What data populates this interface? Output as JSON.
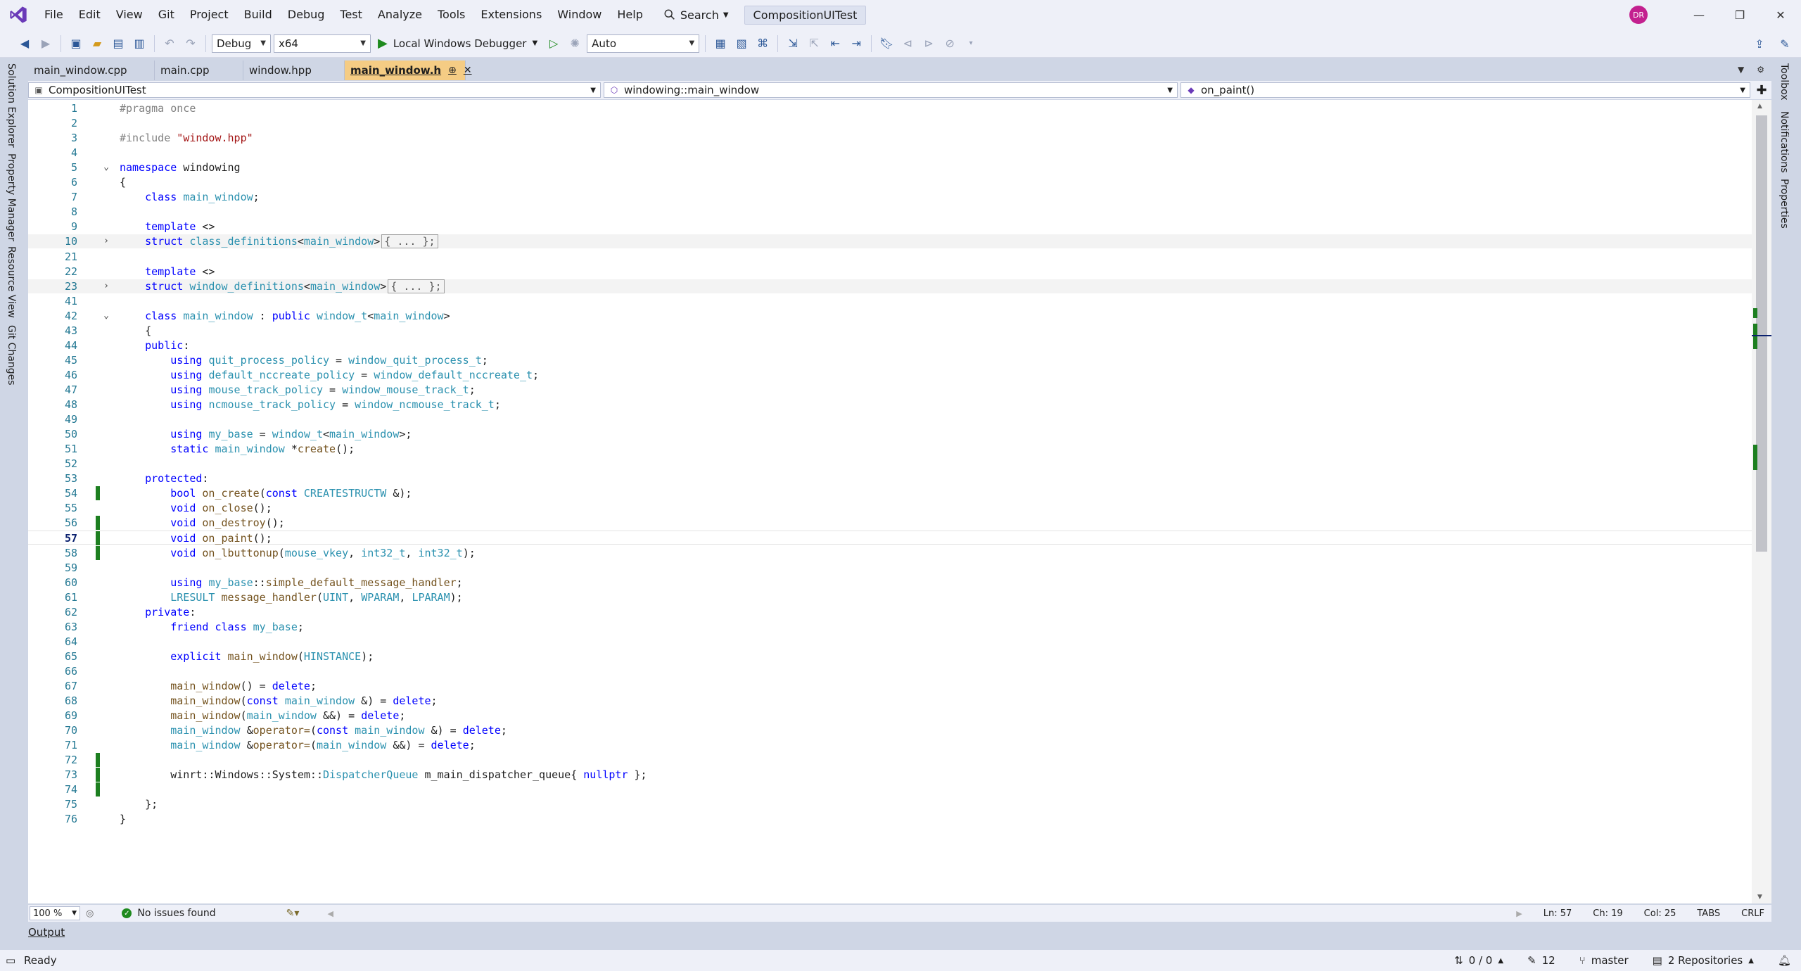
{
  "menu": [
    "File",
    "Edit",
    "View",
    "Git",
    "Project",
    "Build",
    "Debug",
    "Test",
    "Analyze",
    "Tools",
    "Extensions",
    "Window",
    "Help"
  ],
  "search_label": "Search",
  "solution_name": "CompositionUITest",
  "user_initials": "DR",
  "toolbar": {
    "config": "Debug",
    "platform": "x64",
    "debugger_label": "Local Windows Debugger",
    "target": "Auto"
  },
  "left_tool_tabs": [
    "Solution Explorer",
    "Property Manager",
    "Resource View",
    "Git Changes"
  ],
  "right_tool_tabs": [
    "Toolbox",
    "Notifications",
    "Properties"
  ],
  "doc_tabs": [
    "main_window.cpp",
    "main.cpp",
    "window.hpp",
    "main_window.h"
  ],
  "nav": {
    "project": "CompositionUITest",
    "scope": "windowing::main_window",
    "member": "on_paint()"
  },
  "code_lines": [
    {
      "n": 1,
      "tokens": [
        [
          "p",
          "#pragma once"
        ]
      ]
    },
    {
      "n": 2,
      "tokens": []
    },
    {
      "n": 3,
      "tokens": [
        [
          "p",
          "#include "
        ],
        [
          "s",
          "\"window.hpp\""
        ]
      ]
    },
    {
      "n": 4,
      "tokens": []
    },
    {
      "n": 5,
      "fold": "open",
      "tokens": [
        [
          "k",
          "namespace"
        ],
        [
          "pl",
          " windowing"
        ]
      ]
    },
    {
      "n": 6,
      "tokens": [
        [
          "pl",
          "{"
        ]
      ]
    },
    {
      "n": 7,
      "tokens": [
        [
          "pl",
          "    "
        ],
        [
          "k",
          "class"
        ],
        [
          "pl",
          " "
        ],
        [
          "t",
          "main_window"
        ],
        [
          "pl",
          ";"
        ]
      ]
    },
    {
      "n": 8,
      "tokens": []
    },
    {
      "n": 9,
      "tokens": [
        [
          "pl",
          "    "
        ],
        [
          "k",
          "template"
        ],
        [
          "pl",
          " <>"
        ]
      ]
    },
    {
      "n": 10,
      "fold": "closed",
      "collapsed": true,
      "tokens": [
        [
          "pl",
          "    "
        ],
        [
          "k",
          "struct"
        ],
        [
          "pl",
          " "
        ],
        [
          "t",
          "class_definitions"
        ],
        [
          "pl",
          "<"
        ],
        [
          "t",
          "main_window"
        ],
        [
          "pl",
          ">"
        ],
        [
          "ph",
          "{ ... };"
        ]
      ]
    },
    {
      "n": 21,
      "tokens": []
    },
    {
      "n": 22,
      "tokens": [
        [
          "pl",
          "    "
        ],
        [
          "k",
          "template"
        ],
        [
          "pl",
          " <>"
        ]
      ]
    },
    {
      "n": 23,
      "fold": "closed",
      "collapsed": true,
      "tokens": [
        [
          "pl",
          "    "
        ],
        [
          "k",
          "struct"
        ],
        [
          "pl",
          " "
        ],
        [
          "t",
          "window_definitions"
        ],
        [
          "pl",
          "<"
        ],
        [
          "t",
          "main_window"
        ],
        [
          "pl",
          ">"
        ],
        [
          "ph",
          "{ ... };"
        ]
      ]
    },
    {
      "n": 41,
      "tokens": []
    },
    {
      "n": 42,
      "fold": "open",
      "tokens": [
        [
          "pl",
          "    "
        ],
        [
          "k",
          "class"
        ],
        [
          "pl",
          " "
        ],
        [
          "t",
          "main_window"
        ],
        [
          "pl",
          " : "
        ],
        [
          "k",
          "public"
        ],
        [
          "pl",
          " "
        ],
        [
          "t",
          "window_t"
        ],
        [
          "pl",
          "<"
        ],
        [
          "t",
          "main_window"
        ],
        [
          "pl",
          ">"
        ]
      ]
    },
    {
      "n": 43,
      "tokens": [
        [
          "pl",
          "    {"
        ]
      ]
    },
    {
      "n": 44,
      "tokens": [
        [
          "pl",
          "    "
        ],
        [
          "k",
          "public"
        ],
        [
          "pl",
          ":"
        ]
      ]
    },
    {
      "n": 45,
      "tokens": [
        [
          "pl",
          "        "
        ],
        [
          "k",
          "using"
        ],
        [
          "pl",
          " "
        ],
        [
          "t",
          "quit_process_policy"
        ],
        [
          "pl",
          " = "
        ],
        [
          "t",
          "window_quit_process_t"
        ],
        [
          "pl",
          ";"
        ]
      ]
    },
    {
      "n": 46,
      "tokens": [
        [
          "pl",
          "        "
        ],
        [
          "k",
          "using"
        ],
        [
          "pl",
          " "
        ],
        [
          "t",
          "default_nccreate_policy"
        ],
        [
          "pl",
          " = "
        ],
        [
          "t",
          "window_default_nccreate_t"
        ],
        [
          "pl",
          ";"
        ]
      ]
    },
    {
      "n": 47,
      "tokens": [
        [
          "pl",
          "        "
        ],
        [
          "k",
          "using"
        ],
        [
          "pl",
          " "
        ],
        [
          "t",
          "mouse_track_policy"
        ],
        [
          "pl",
          " = "
        ],
        [
          "t",
          "window_mouse_track_t"
        ],
        [
          "pl",
          ";"
        ]
      ]
    },
    {
      "n": 48,
      "tokens": [
        [
          "pl",
          "        "
        ],
        [
          "k",
          "using"
        ],
        [
          "pl",
          " "
        ],
        [
          "t",
          "ncmouse_track_policy"
        ],
        [
          "pl",
          " = "
        ],
        [
          "t",
          "window_ncmouse_track_t"
        ],
        [
          "pl",
          ";"
        ]
      ]
    },
    {
      "n": 49,
      "tokens": []
    },
    {
      "n": 50,
      "tokens": [
        [
          "pl",
          "        "
        ],
        [
          "k",
          "using"
        ],
        [
          "pl",
          " "
        ],
        [
          "t",
          "my_base"
        ],
        [
          "pl",
          " = "
        ],
        [
          "t",
          "window_t"
        ],
        [
          "pl",
          "<"
        ],
        [
          "t",
          "main_window"
        ],
        [
          "pl",
          ">;"
        ]
      ]
    },
    {
      "n": 51,
      "tokens": [
        [
          "pl",
          "        "
        ],
        [
          "k",
          "static"
        ],
        [
          "pl",
          " "
        ],
        [
          "t",
          "main_window"
        ],
        [
          "pl",
          " *"
        ],
        [
          "m",
          "create"
        ],
        [
          "pl",
          "();"
        ]
      ]
    },
    {
      "n": 52,
      "tokens": []
    },
    {
      "n": 53,
      "tokens": [
        [
          "pl",
          "    "
        ],
        [
          "k",
          "protected"
        ],
        [
          "pl",
          ":"
        ]
      ]
    },
    {
      "n": 54,
      "change": true,
      "tokens": [
        [
          "pl",
          "        "
        ],
        [
          "k",
          "bool"
        ],
        [
          "pl",
          " "
        ],
        [
          "m",
          "on_create"
        ],
        [
          "pl",
          "("
        ],
        [
          "k",
          "const"
        ],
        [
          "pl",
          " "
        ],
        [
          "t",
          "CREATESTRUCTW"
        ],
        [
          "pl",
          " &);"
        ]
      ]
    },
    {
      "n": 55,
      "tokens": [
        [
          "pl",
          "        "
        ],
        [
          "k",
          "void"
        ],
        [
          "pl",
          " "
        ],
        [
          "m",
          "on_close"
        ],
        [
          "pl",
          "();"
        ]
      ]
    },
    {
      "n": 56,
      "change": true,
      "tokens": [
        [
          "pl",
          "        "
        ],
        [
          "k",
          "void"
        ],
        [
          "pl",
          " "
        ],
        [
          "m",
          "on_destroy"
        ],
        [
          "pl",
          "();"
        ]
      ]
    },
    {
      "n": 57,
      "change": true,
      "current": true,
      "tokens": [
        [
          "pl",
          "        "
        ],
        [
          "k",
          "void"
        ],
        [
          "pl",
          " "
        ],
        [
          "m",
          "on_paint"
        ],
        [
          "pl",
          "();"
        ]
      ]
    },
    {
      "n": 58,
      "change": true,
      "tokens": [
        [
          "pl",
          "        "
        ],
        [
          "k",
          "void"
        ],
        [
          "pl",
          " "
        ],
        [
          "m",
          "on_lbuttonup"
        ],
        [
          "pl",
          "("
        ],
        [
          "t",
          "mouse_vkey"
        ],
        [
          "pl",
          ", "
        ],
        [
          "t",
          "int32_t"
        ],
        [
          "pl",
          ", "
        ],
        [
          "t",
          "int32_t"
        ],
        [
          "pl",
          ");"
        ]
      ]
    },
    {
      "n": 59,
      "tokens": []
    },
    {
      "n": 60,
      "tokens": [
        [
          "pl",
          "        "
        ],
        [
          "k",
          "using"
        ],
        [
          "pl",
          " "
        ],
        [
          "t",
          "my_base"
        ],
        [
          "pl",
          "::"
        ],
        [
          "m",
          "simple_default_message_handler"
        ],
        [
          "pl",
          ";"
        ]
      ]
    },
    {
      "n": 61,
      "tokens": [
        [
          "pl",
          "        "
        ],
        [
          "t",
          "LRESULT"
        ],
        [
          "pl",
          " "
        ],
        [
          "m",
          "message_handler"
        ],
        [
          "pl",
          "("
        ],
        [
          "t",
          "UINT"
        ],
        [
          "pl",
          ", "
        ],
        [
          "t",
          "WPARAM"
        ],
        [
          "pl",
          ", "
        ],
        [
          "t",
          "LPARAM"
        ],
        [
          "pl",
          ");"
        ]
      ]
    },
    {
      "n": 62,
      "tokens": [
        [
          "pl",
          "    "
        ],
        [
          "k",
          "private"
        ],
        [
          "pl",
          ":"
        ]
      ]
    },
    {
      "n": 63,
      "tokens": [
        [
          "pl",
          "        "
        ],
        [
          "k",
          "friend"
        ],
        [
          "pl",
          " "
        ],
        [
          "k",
          "class"
        ],
        [
          "pl",
          " "
        ],
        [
          "t",
          "my_base"
        ],
        [
          "pl",
          ";"
        ]
      ]
    },
    {
      "n": 64,
      "tokens": []
    },
    {
      "n": 65,
      "tokens": [
        [
          "pl",
          "        "
        ],
        [
          "k",
          "explicit"
        ],
        [
          "pl",
          " "
        ],
        [
          "m",
          "main_window"
        ],
        [
          "pl",
          "("
        ],
        [
          "t",
          "HINSTANCE"
        ],
        [
          "pl",
          ");"
        ]
      ]
    },
    {
      "n": 66,
      "tokens": []
    },
    {
      "n": 67,
      "tokens": [
        [
          "pl",
          "        "
        ],
        [
          "m",
          "main_window"
        ],
        [
          "pl",
          "() = "
        ],
        [
          "k",
          "delete"
        ],
        [
          "pl",
          ";"
        ]
      ]
    },
    {
      "n": 68,
      "tokens": [
        [
          "pl",
          "        "
        ],
        [
          "m",
          "main_window"
        ],
        [
          "pl",
          "("
        ],
        [
          "k",
          "const"
        ],
        [
          "pl",
          " "
        ],
        [
          "t",
          "main_window"
        ],
        [
          "pl",
          " &) = "
        ],
        [
          "k",
          "delete"
        ],
        [
          "pl",
          ";"
        ]
      ]
    },
    {
      "n": 69,
      "tokens": [
        [
          "pl",
          "        "
        ],
        [
          "m",
          "main_window"
        ],
        [
          "pl",
          "("
        ],
        [
          "t",
          "main_window"
        ],
        [
          "pl",
          " &&) = "
        ],
        [
          "k",
          "delete"
        ],
        [
          "pl",
          ";"
        ]
      ]
    },
    {
      "n": 70,
      "tokens": [
        [
          "pl",
          "        "
        ],
        [
          "t",
          "main_window"
        ],
        [
          "pl",
          " &"
        ],
        [
          "m",
          "operator="
        ],
        [
          "pl",
          "("
        ],
        [
          "k",
          "const"
        ],
        [
          "pl",
          " "
        ],
        [
          "t",
          "main_window"
        ],
        [
          "pl",
          " &) = "
        ],
        [
          "k",
          "delete"
        ],
        [
          "pl",
          ";"
        ]
      ]
    },
    {
      "n": 71,
      "tokens": [
        [
          "pl",
          "        "
        ],
        [
          "t",
          "main_window"
        ],
        [
          "pl",
          " &"
        ],
        [
          "m",
          "operator="
        ],
        [
          "pl",
          "("
        ],
        [
          "t",
          "main_window"
        ],
        [
          "pl",
          " &&) = "
        ],
        [
          "k",
          "delete"
        ],
        [
          "pl",
          ";"
        ]
      ]
    },
    {
      "n": 72,
      "change": true,
      "tokens": []
    },
    {
      "n": 73,
      "change": true,
      "tokens": [
        [
          "pl",
          "        winrt::Windows::System::"
        ],
        [
          "t",
          "DispatcherQueue"
        ],
        [
          "pl",
          " m_main_dispatcher_queue{ "
        ],
        [
          "k",
          "nullptr"
        ],
        [
          "pl",
          " };"
        ]
      ]
    },
    {
      "n": 74,
      "change": true,
      "tokens": []
    },
    {
      "n": 75,
      "tokens": [
        [
          "pl",
          "    };"
        ]
      ]
    },
    {
      "n": 76,
      "tokens": [
        [
          "pl",
          "}"
        ]
      ]
    }
  ],
  "editor_status": {
    "zoom": "100 %",
    "issues": "No issues found",
    "ln": "Ln: 57",
    "ch": "Ch: 19",
    "col": "Col: 25",
    "tabs": "TABS",
    "eol": "CRLF"
  },
  "output_tab": "Output",
  "statusbar": {
    "ready": "Ready",
    "sync": "0 / 0",
    "edits": "12",
    "branch": "master",
    "repos": "2 Repositories"
  }
}
